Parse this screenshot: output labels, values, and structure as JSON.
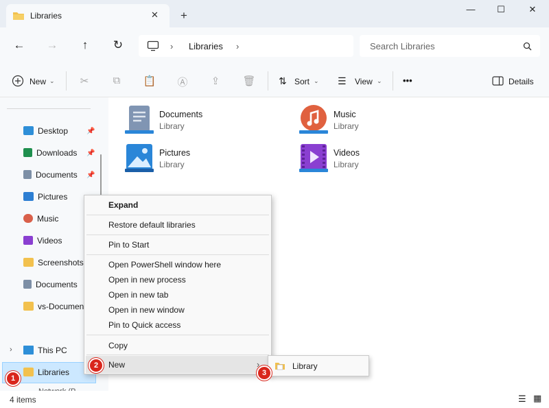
{
  "window": {
    "tab_title": "Libraries",
    "tab_close": "✕",
    "new_tab": "+",
    "minimize": "—",
    "maximize": "☐",
    "close": "✕"
  },
  "address": {
    "breadcrumb": "Libraries",
    "search_placeholder": "Search Libraries"
  },
  "toolbar": {
    "new_label": "New",
    "sort_label": "Sort",
    "view_label": "View",
    "more_label": "•••",
    "details_label": "Details"
  },
  "sidebar": {
    "items": [
      {
        "label": "Desktop",
        "color": "#2e8fd8",
        "pinned": true
      },
      {
        "label": "Downloads",
        "color": "#1f8f4e",
        "pinned": true
      },
      {
        "label": "Documents",
        "color": "#7d8fa6",
        "pinned": true
      },
      {
        "label": "Pictures",
        "color": "#2d7fd3",
        "pinned": true
      },
      {
        "label": "Music",
        "color": "#d9604a",
        "pinned": false
      },
      {
        "label": "Videos",
        "color": "#8a3fd1",
        "pinned": false
      },
      {
        "label": "Screenshots",
        "color": "#f2c14e",
        "pinned": false
      },
      {
        "label": "Documents",
        "color": "#7d8fa6",
        "pinned": false
      },
      {
        "label": "vs-Documents",
        "color": "#f2c14e",
        "pinned": false
      }
    ],
    "this_pc": "This PC",
    "libraries": "Libraries",
    "network_partial": "Network (P..."
  },
  "libraries": [
    {
      "name": "Documents",
      "type": "Library",
      "color": "#8095b3"
    },
    {
      "name": "Music",
      "type": "Library",
      "color": "#e0613f"
    },
    {
      "name": "Pictures",
      "type": "Library",
      "color": "#2a86d8"
    },
    {
      "name": "Videos",
      "type": "Library",
      "color": "#8a3fd1"
    }
  ],
  "status": {
    "count": "4 items"
  },
  "context_menu": {
    "expand": "Expand",
    "restore": "Restore default libraries",
    "pin_start": "Pin to Start",
    "powershell": "Open PowerShell window here",
    "new_process": "Open in new process",
    "new_tab": "Open in new tab",
    "new_window": "Open in new window",
    "quick_access": "Pin to Quick access",
    "copy": "Copy",
    "new": "New",
    "submenu_library": "Library"
  },
  "badges": {
    "one": "1",
    "two": "2",
    "three": "3"
  },
  "colors": {
    "accent": "#0067c0",
    "badge": "#d9261c",
    "selection": "#cce8ff"
  }
}
